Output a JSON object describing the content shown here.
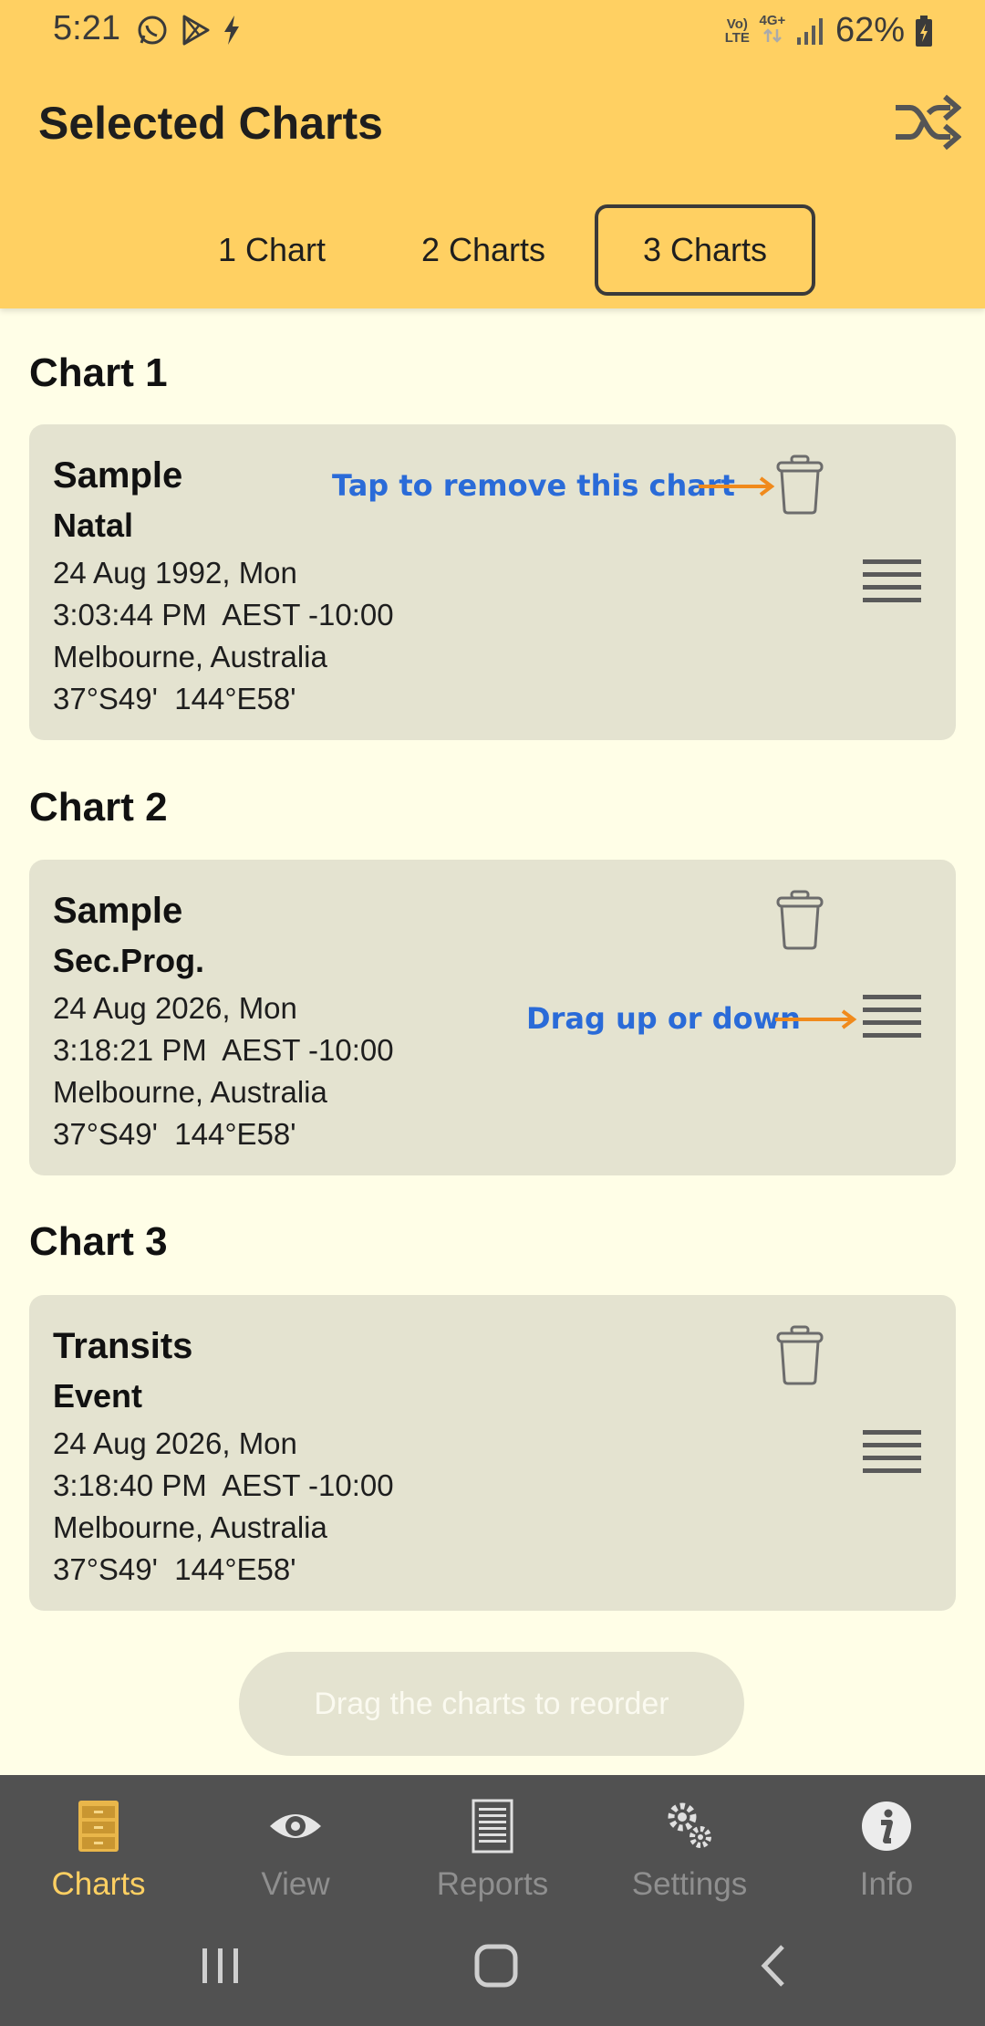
{
  "status_bar": {
    "time": "5:21",
    "network_top": "Vo)",
    "network_bottom": "LTE",
    "network_gen": "4G+",
    "battery": "62%"
  },
  "header": {
    "title": "Selected Charts",
    "tabs": [
      {
        "label": "1 Chart",
        "selected": false
      },
      {
        "label": "2 Charts",
        "selected": false
      },
      {
        "label": "3 Charts",
        "selected": true
      }
    ]
  },
  "charts": [
    {
      "section": "Chart 1",
      "name": "Sample",
      "type": "Natal",
      "date": "24 Aug 1992, Mon",
      "time": "3:03:44 PM  AEST -10:00",
      "place": "Melbourne, Australia",
      "coords": "37°S49'  144°E58'"
    },
    {
      "section": "Chart 2",
      "name": "Sample",
      "type": "Sec.Prog.",
      "date": "24 Aug 2026, Mon",
      "time": "3:18:21 PM  AEST -10:00",
      "place": "Melbourne, Australia",
      "coords": "37°S49'  144°E58'"
    },
    {
      "section": "Chart 3",
      "name": "Transits",
      "type": "Event",
      "date": "24 Aug 2026, Mon",
      "time": "3:18:40 PM  AEST -10:00",
      "place": "Melbourne, Australia",
      "coords": "37°S49'  144°E58'"
    }
  ],
  "hints": {
    "remove": "Tap to remove this chart",
    "drag": "Drag up or down"
  },
  "reorder_button": "Drag the charts to reorder",
  "bottom_nav": [
    {
      "label": "Charts",
      "icon": "cabinet-icon",
      "active": true
    },
    {
      "label": "View",
      "icon": "eye-icon",
      "active": false
    },
    {
      "label": "Reports",
      "icon": "report-icon",
      "active": false
    },
    {
      "label": "Settings",
      "icon": "gears-icon",
      "active": false
    },
    {
      "label": "Info",
      "icon": "info-icon",
      "active": false
    }
  ],
  "colors": {
    "header_bg": "#ffd062",
    "page_bg": "#fffee7",
    "card_bg": "#e4e3d0",
    "hint_text": "#2a6bd8",
    "hint_arrow": "#f08a1c",
    "nav_bg": "#515151",
    "nav_active": "#ffd062"
  }
}
